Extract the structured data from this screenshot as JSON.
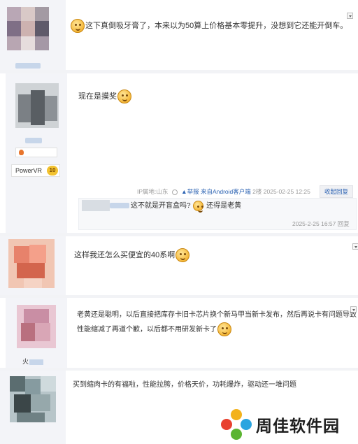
{
  "posts": [
    {
      "text": "这下真倒吸牙膏了，本来以为50算上价格基本零提升，没想到它还能开倒车。"
    },
    {
      "text": "现在是摸奖",
      "badge_label": "PowerVR",
      "badge_level": "10",
      "meta": {
        "ip": "IP属地:山东",
        "report": "举报",
        "source": "来自Android客户端",
        "floor": "2楼",
        "time": "2025-02-25 12:25",
        "fold": "收起回复"
      },
      "reply": {
        "text": "这不就是开盲盒吗?",
        "text2": "还得是老黄",
        "time": "2025-2-25 16:57",
        "reply_label": "回复"
      }
    },
    {
      "text": "这样我还怎么买便宜的40系啊"
    },
    {
      "text_line1": "老黄还是聪明，以后直接把库存卡旧卡芯片换个新马甲当新卡发布，然后再说卡有问题导致",
      "text_line2": "性能缩减了再道个歉，以后都不用研发新卡了",
      "username_visible": "火"
    },
    {
      "text": "买到缩肉卡的有福啦，性能拉胯，价格天价，功耗爆炸，驱动还一堆问题"
    }
  ],
  "watermark": {
    "text": "周佳软件园"
  },
  "colors": {
    "accent": "#2d64b3",
    "sidebar_bg": "#f3f4f8",
    "meta_text": "#999999"
  }
}
